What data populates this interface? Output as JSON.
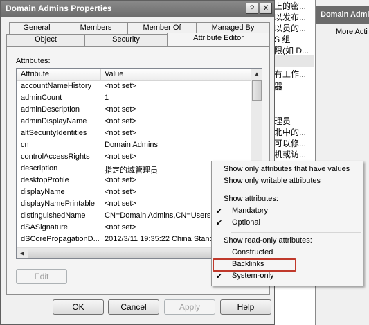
{
  "dialog": {
    "title": "Domain Admins Properties",
    "help_glyph": "?",
    "close_glyph": "X",
    "tabs_back": [
      "General",
      "Members",
      "Member Of",
      "Managed By"
    ],
    "tabs_front": [
      "Object",
      "Security",
      "Attribute Editor"
    ],
    "active_tab": "Attribute Editor",
    "attributes_label": "Attributes:",
    "columns": {
      "attribute": "Attribute",
      "value": "Value"
    },
    "rows": [
      {
        "attribute": "accountNameHistory",
        "value": "<not set>"
      },
      {
        "attribute": "adminCount",
        "value": "1"
      },
      {
        "attribute": "adminDescription",
        "value": "<not set>"
      },
      {
        "attribute": "adminDisplayName",
        "value": "<not set>"
      },
      {
        "attribute": "altSecurityIdentities",
        "value": "<not set>"
      },
      {
        "attribute": "cn",
        "value": "Domain Admins"
      },
      {
        "attribute": "controlAccessRights",
        "value": "<not set>"
      },
      {
        "attribute": "description",
        "value": "指定的域管理员"
      },
      {
        "attribute": "desktopProfile",
        "value": "<not set>"
      },
      {
        "attribute": "displayName",
        "value": "<not set>"
      },
      {
        "attribute": "displayNamePrintable",
        "value": "<not set>"
      },
      {
        "attribute": "distinguishedName",
        "value": "CN=Domain Admins,CN=Users,D"
      },
      {
        "attribute": "dSASignature",
        "value": "<not set>"
      },
      {
        "attribute": "dSCorePropagationD...",
        "value": "2012/3/11 19:35:22 China Stand"
      }
    ],
    "buttons": {
      "edit": "Edit",
      "ok": "OK",
      "cancel": "Cancel",
      "apply": "Apply",
      "help": "Help"
    }
  },
  "context_menu": {
    "items": [
      {
        "label": "Show only attributes that have values",
        "checked": false
      },
      {
        "label": "Show only writable attributes",
        "checked": false
      },
      {
        "label": "Show attributes:",
        "checked": false
      },
      {
        "label": "Mandatory",
        "checked": true
      },
      {
        "label": "Optional",
        "checked": true
      },
      {
        "label": "Show read-only attributes:",
        "checked": false
      },
      {
        "label": "Constructed",
        "checked": false
      },
      {
        "label": "Backlinks",
        "checked": false
      },
      {
        "label": "System-only",
        "checked": true
      }
    ],
    "check_glyph": "✔"
  },
  "background": {
    "lines": [
      "上的密...",
      "以发布...",
      "以员的...",
      "S 组",
      "限(如 D...",
      "有工作...",
      "器",
      "理员",
      "北中的...",
      "可以修...",
      "机或访..."
    ],
    "window_title": "Domain Admi",
    "window_action": "More Acti"
  },
  "colors": {
    "highlight_box": "#c0392b",
    "title_bar": "#6c6c6c"
  }
}
